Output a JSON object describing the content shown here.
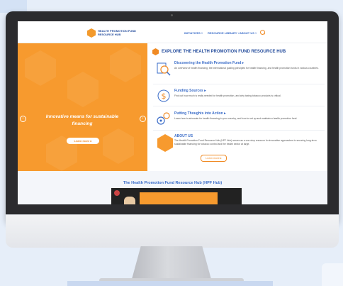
{
  "header": {
    "logo_line1": "HEALTH PROMOTION FUND",
    "logo_line2": "RESOURCE HUB",
    "nav": [
      "INITIATIVES ˅",
      "RESOURCE LIBRARY ˅",
      "ABOUT US ˅"
    ]
  },
  "hero": {
    "title_line1": "Innovative means for sustainable",
    "title_line2": "financing",
    "button": "Learn more ▸",
    "arrow_left": "‹",
    "arrow_right": "›"
  },
  "explore": {
    "title": "EXPLORE THE HEALTH PROMOTION FUND RESOURCE HUB",
    "items": [
      {
        "name": "Discovering the Health Promotion Fund ▸",
        "desc": "An overview of health financing, the international guiding principles for health financing, and health promotion funds in various countries."
      },
      {
        "name": "Funding Sources ▸",
        "desc": "Find out how much is really needed for health promotion, and why taxing tobacco products is critical."
      },
      {
        "name": "Putting Thoughts into Action ▸",
        "desc": "Learn how to advocate for health financing in your country, and how to set up and maintain a health promotion fund."
      }
    ],
    "about": {
      "name": "ABOUT US",
      "desc": "The Health Promotion Fund Resource Hub (HPF Hub) serves as a one-stop resource for innovative approaches to securing long-term sustainable financing for tobacco control and the health sector at large.",
      "button": "Learn more ▸"
    }
  },
  "video": {
    "section_title": "The Health Promotion Fund Resource Hub (HPF Hub)"
  },
  "colors": {
    "accent": "#f79a2e",
    "brand_blue": "#244c9c",
    "link_blue": "#3a6cc8"
  }
}
